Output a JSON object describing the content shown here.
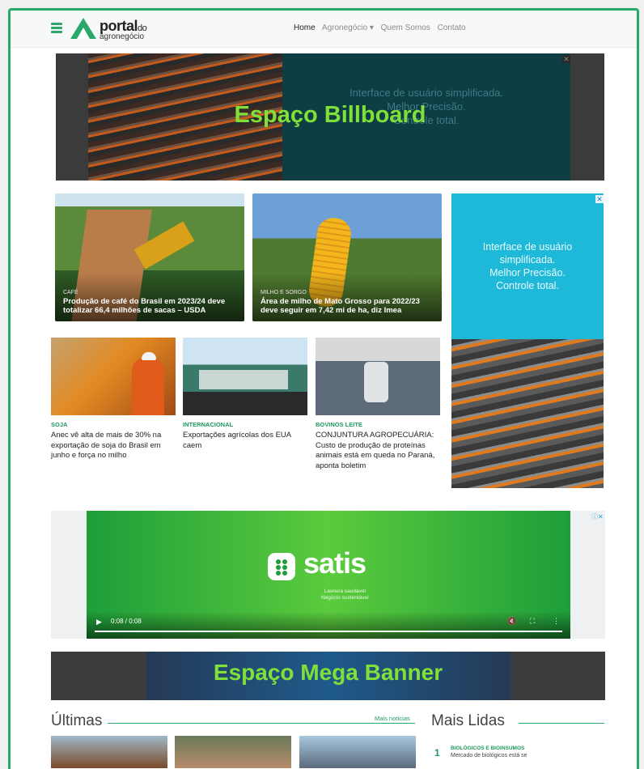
{
  "header": {
    "logo_main": "portal",
    "logo_do": "do",
    "logo_sub": "agronegócio",
    "nav": [
      {
        "label": "Home"
      },
      {
        "label": "Agronegócio ▾"
      },
      {
        "label": "Quem Somos"
      },
      {
        "label": "Contato"
      }
    ]
  },
  "billboard": {
    "title": "Espaço Billboard",
    "ghost_lines": [
      "Interface de usuário simplificada.",
      "Melhor Precisão.",
      "Controle total."
    ]
  },
  "featured": [
    {
      "category": "CAFÉ",
      "title": "Produção de café do Brasil em 2023/24 deve totalizar 66,4 milhões de sacas – USDA"
    },
    {
      "category": "MILHO E SORGO",
      "title": "Área de milho de Mato Grosso para 2022/23 deve seguir em 7,42 mi de ha, diz Imea"
    }
  ],
  "side_ad": {
    "text_lines": [
      "Interface de usuário",
      "simplificada.",
      "Melhor Precisão.",
      "Controle total."
    ]
  },
  "news": [
    {
      "category": "SOJA",
      "title": "Anec vê alta de mais de 30% na exportação de soja do Brasil em junho e força no milho"
    },
    {
      "category": "INTERNACIONAL",
      "title": "Exportações agrícolas dos EUA caem"
    },
    {
      "category": "BOVINOS LEITE",
      "title": "CONJUNTURA AGROPECUÁRIA: Custo de produção de proteínas animais está em queda no Paraná, aponta boletim"
    }
  ],
  "video_ad": {
    "brand": "satis",
    "tagline1": "Lavoura saudável",
    "tagline2": "Negócio sustentável",
    "time": "0:08 / 0:08",
    "progress": 1.0
  },
  "mega_banner": {
    "title": "Espaço Mega Banner"
  },
  "ultimas": {
    "heading": "Últimas",
    "more_link": "Mais notícias"
  },
  "mais_lidas": {
    "heading": "Mais Lidas",
    "items": [
      {
        "rank": "1",
        "category": "BIOLÓGICOS E BIOINSUMOS",
        "title": "Mercado de biológicos está se"
      }
    ]
  },
  "colors": {
    "accent": "#2aa86a",
    "billboard_text": "#7fe03a",
    "side_ad_bg": "#1eb9d8"
  }
}
